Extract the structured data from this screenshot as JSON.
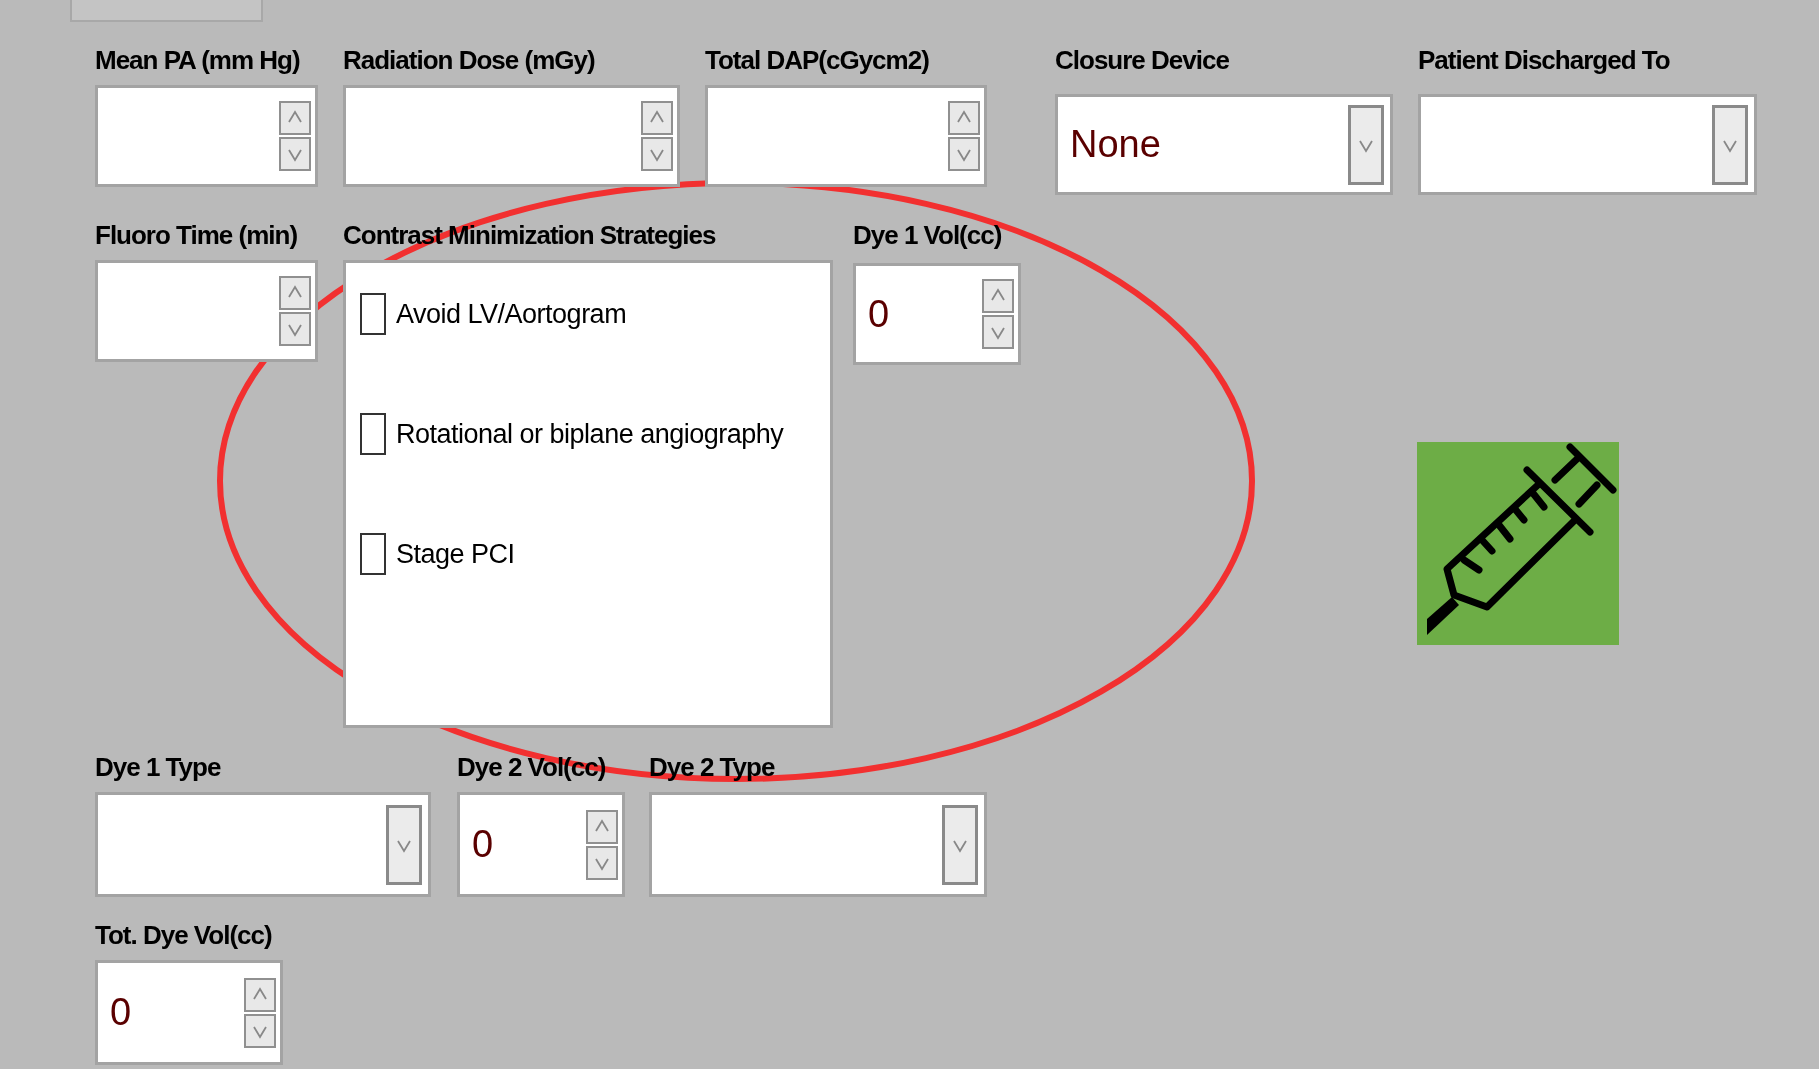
{
  "rows": [
    [
      {
        "kind": "spin",
        "label": "Mean PA (mm Hg)"
      },
      {
        "kind": "spin",
        "label": "Radiation Dose (mGy)"
      },
      {
        "kind": "spin",
        "label": "Total DAP(cGycm2)"
      },
      {
        "kind": "select",
        "label": "Closure Device",
        "value": "None"
      },
      {
        "kind": "select",
        "label": "Patient Discharged To"
      }
    ],
    [
      {
        "kind": "spin",
        "label": "Fluoro Time (min)"
      },
      {
        "kind": "checklist",
        "label": "Contrast Minimization Strategies",
        "items": [
          {
            "label": "Avoid LV/Aortogram",
            "checked": false
          },
          {
            "label": "Rotational or biplane angiography",
            "checked": false
          },
          {
            "label": "Stage PCI",
            "checked": false
          }
        ]
      },
      {
        "kind": "spin",
        "label": "Dye 1 Vol(cc)",
        "value": "0"
      }
    ],
    [
      {
        "kind": "select",
        "label": "Dye 1 Type"
      },
      {
        "kind": "spin",
        "label": "Dye 2 Vol(cc)",
        "value": "0"
      },
      {
        "kind": "select",
        "label": "Dye 2 Type"
      }
    ],
    [
      {
        "kind": "spin",
        "label": "Tot. Dye Vol(cc)",
        "value": "0"
      }
    ]
  ]
}
